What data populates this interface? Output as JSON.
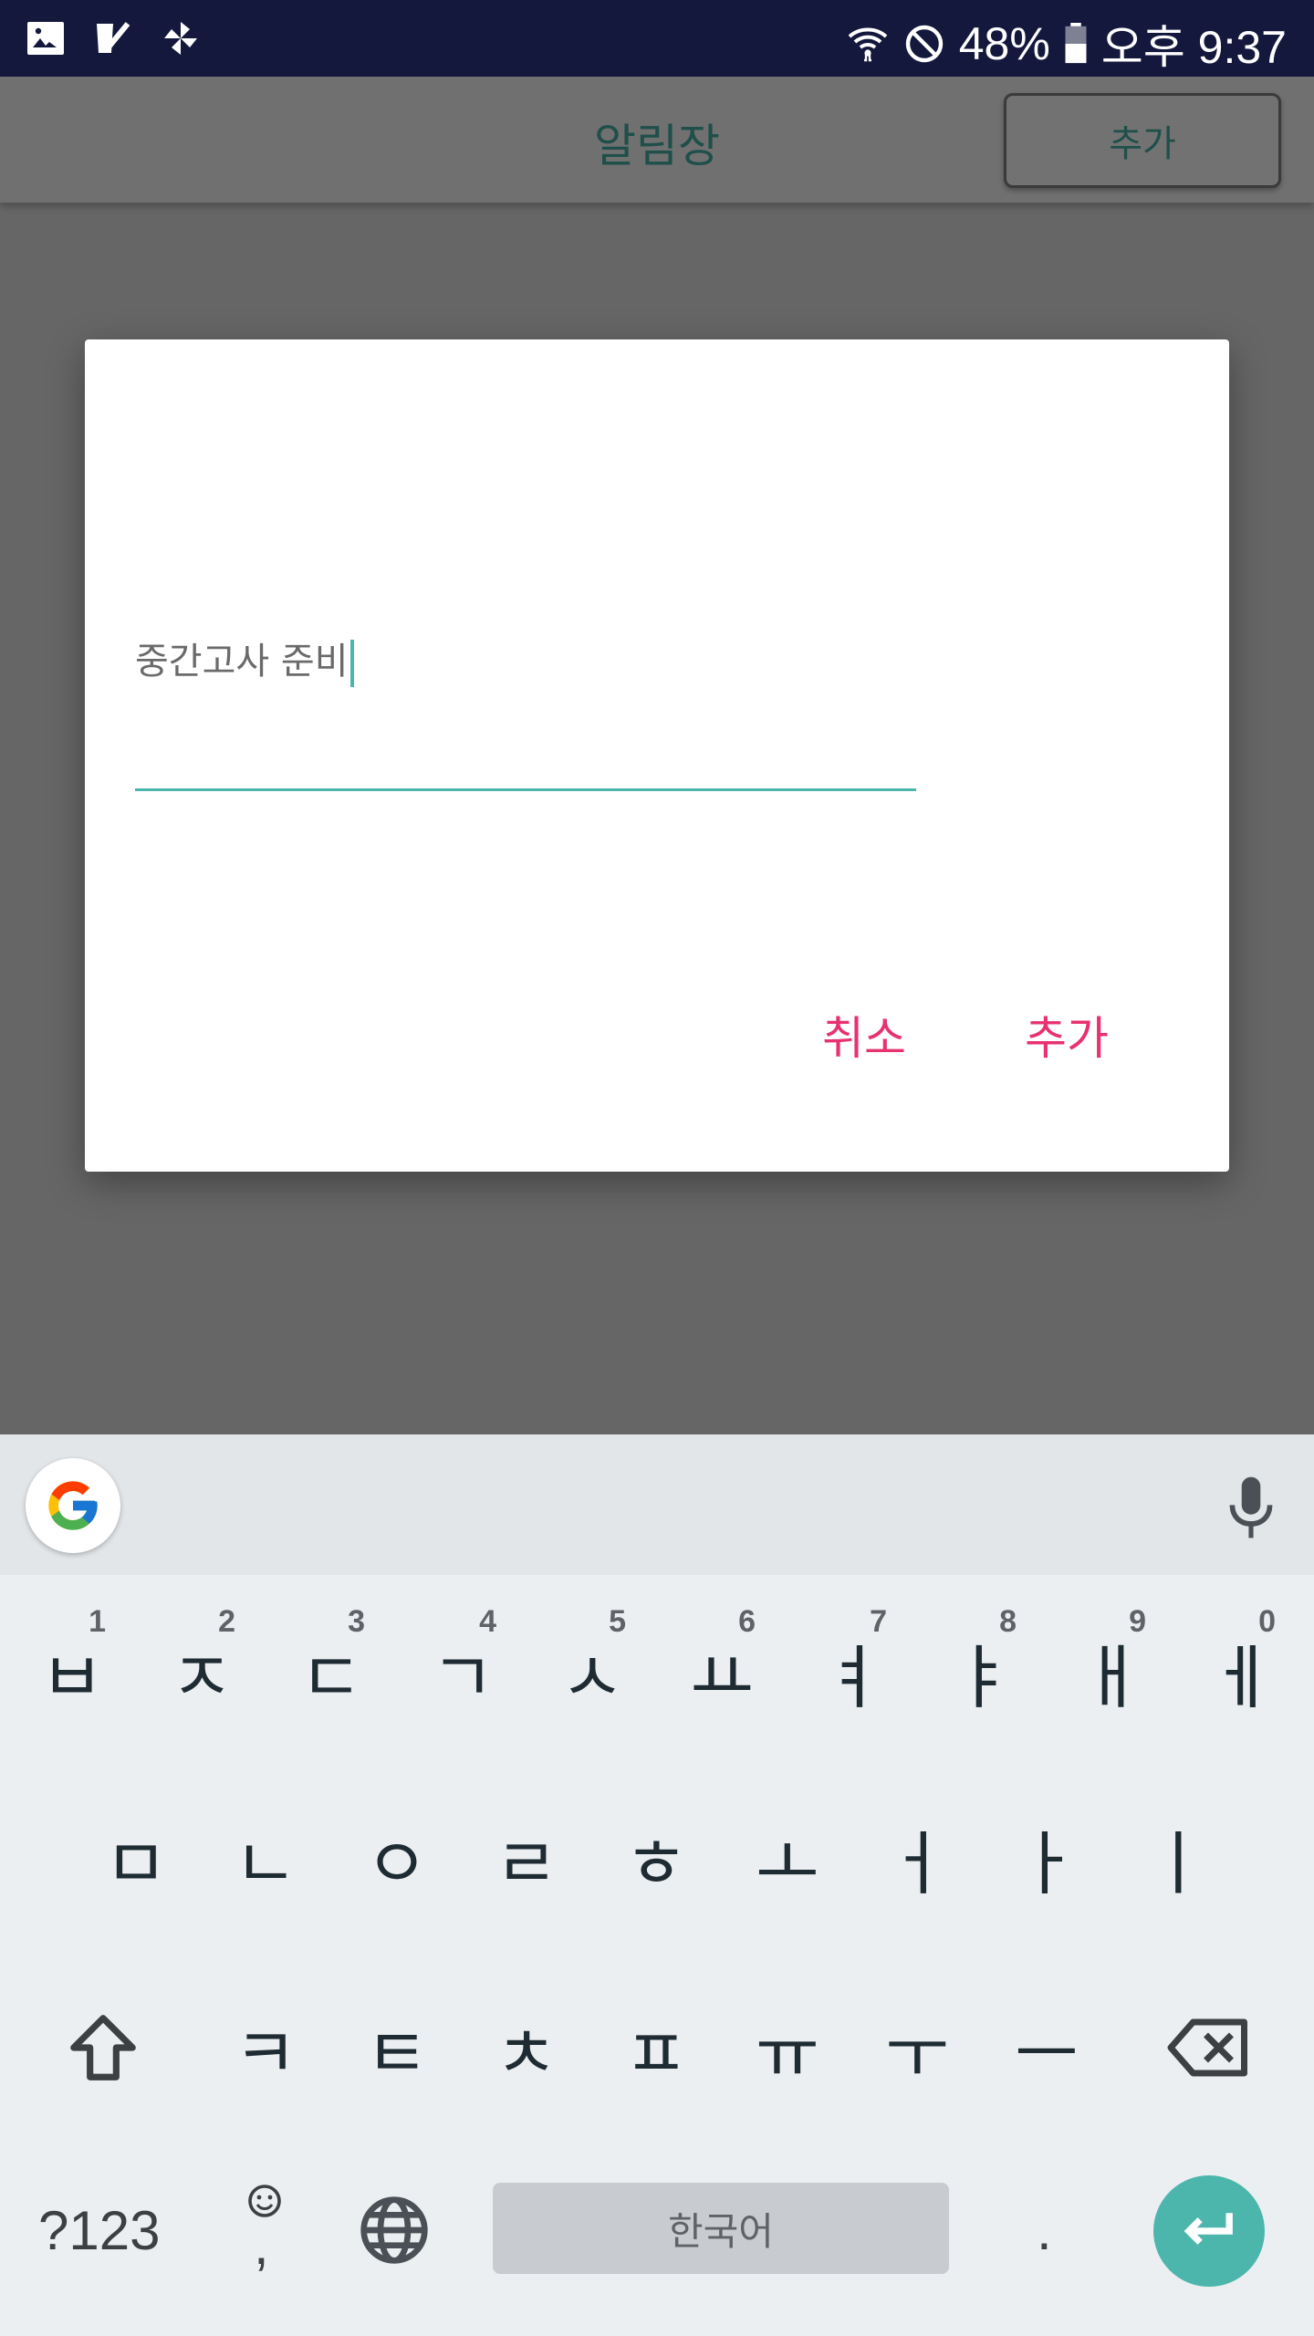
{
  "status_bar": {
    "battery": "48%",
    "time": "오후 9:37",
    "left_icons": [
      "gallery-icon",
      "task-check-icon",
      "pinwheel-icon"
    ],
    "right_icons": [
      "wifi-icon",
      "do-not-disturb-icon",
      "battery-icon"
    ]
  },
  "app_bar": {
    "title": "알림장",
    "add_button_label": "추가"
  },
  "dialog": {
    "input_value": "중간고사 준비",
    "cancel_label": "취소",
    "add_label": "추가",
    "accent_color": "#4db6ac",
    "button_color": "#e8316f"
  },
  "keyboard": {
    "row1": [
      {
        "key": "ㅂ",
        "hint": "1"
      },
      {
        "key": "ㅈ",
        "hint": "2"
      },
      {
        "key": "ㄷ",
        "hint": "3"
      },
      {
        "key": "ㄱ",
        "hint": "4"
      },
      {
        "key": "ㅅ",
        "hint": "5"
      },
      {
        "key": "ㅛ",
        "hint": "6"
      },
      {
        "key": "ㅕ",
        "hint": "7"
      },
      {
        "key": "ㅑ",
        "hint": "8"
      },
      {
        "key": "ㅐ",
        "hint": "9"
      },
      {
        "key": "ㅔ",
        "hint": "0"
      }
    ],
    "row2": [
      "ㅁ",
      "ㄴ",
      "ㅇ",
      "ㄹ",
      "ㅎ",
      "ㅗ",
      "ㅓ",
      "ㅏ",
      "ㅣ"
    ],
    "row3": [
      "ㅋ",
      "ㅌ",
      "ㅊ",
      "ㅍ",
      "ㅠ",
      "ㅜ",
      "ㅡ"
    ],
    "symbols_label": "?123",
    "comma_label": ",",
    "space_label": "한국어",
    "period_label": "."
  }
}
